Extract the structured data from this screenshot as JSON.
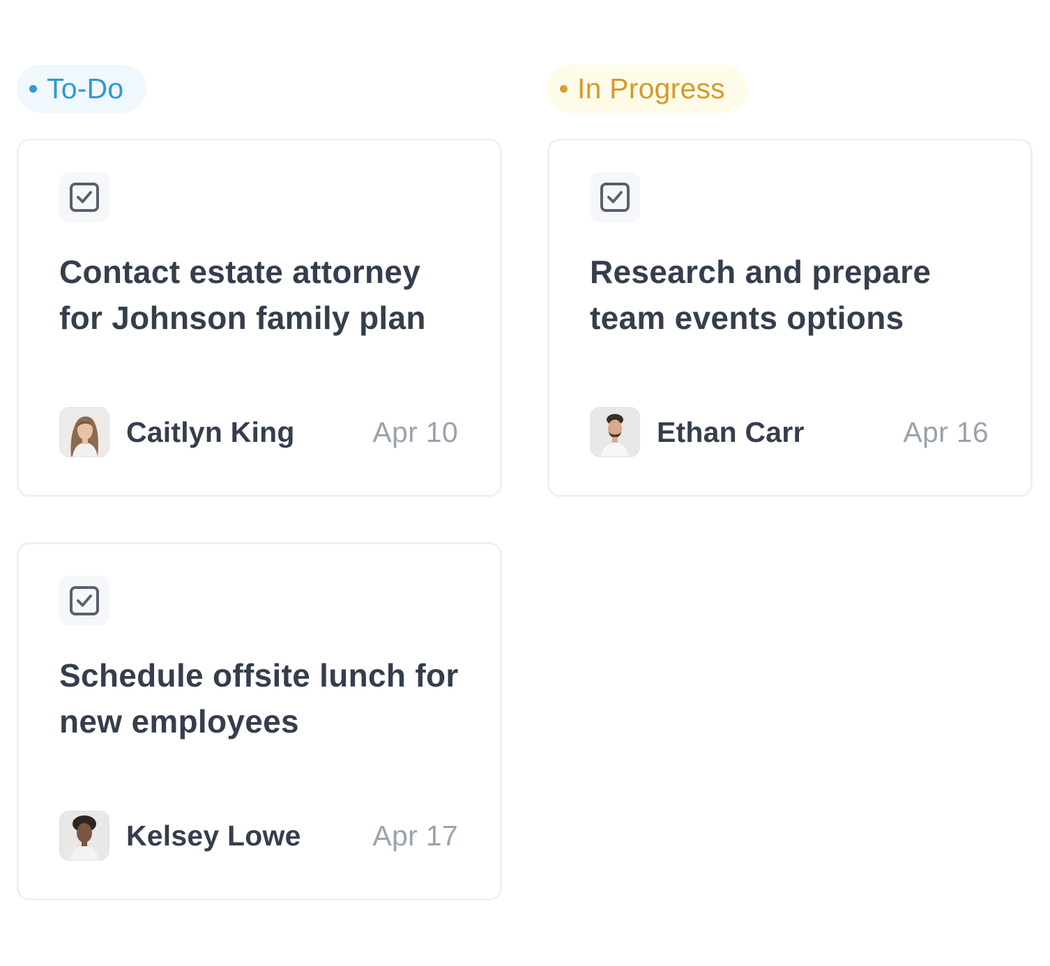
{
  "columns": [
    {
      "label": "To-Do",
      "color": "#2b9bd3",
      "cards": [
        {
          "title": "Contact estate attorney for Johnson family plan",
          "assignee": "Caitlyn King",
          "due": "Apr 10"
        },
        {
          "title": "Schedule offsite lunch for new employees",
          "assignee": "Kelsey Lowe",
          "due": "Apr 17"
        }
      ]
    },
    {
      "label": "In Progress",
      "color": "#d49a2b",
      "cards": [
        {
          "title": "Research and prepare team events options",
          "assignee": "Ethan Carr",
          "due": "Apr 16"
        }
      ]
    }
  ],
  "icons": {
    "task": "checkbox-icon",
    "status": "dot-icon"
  }
}
